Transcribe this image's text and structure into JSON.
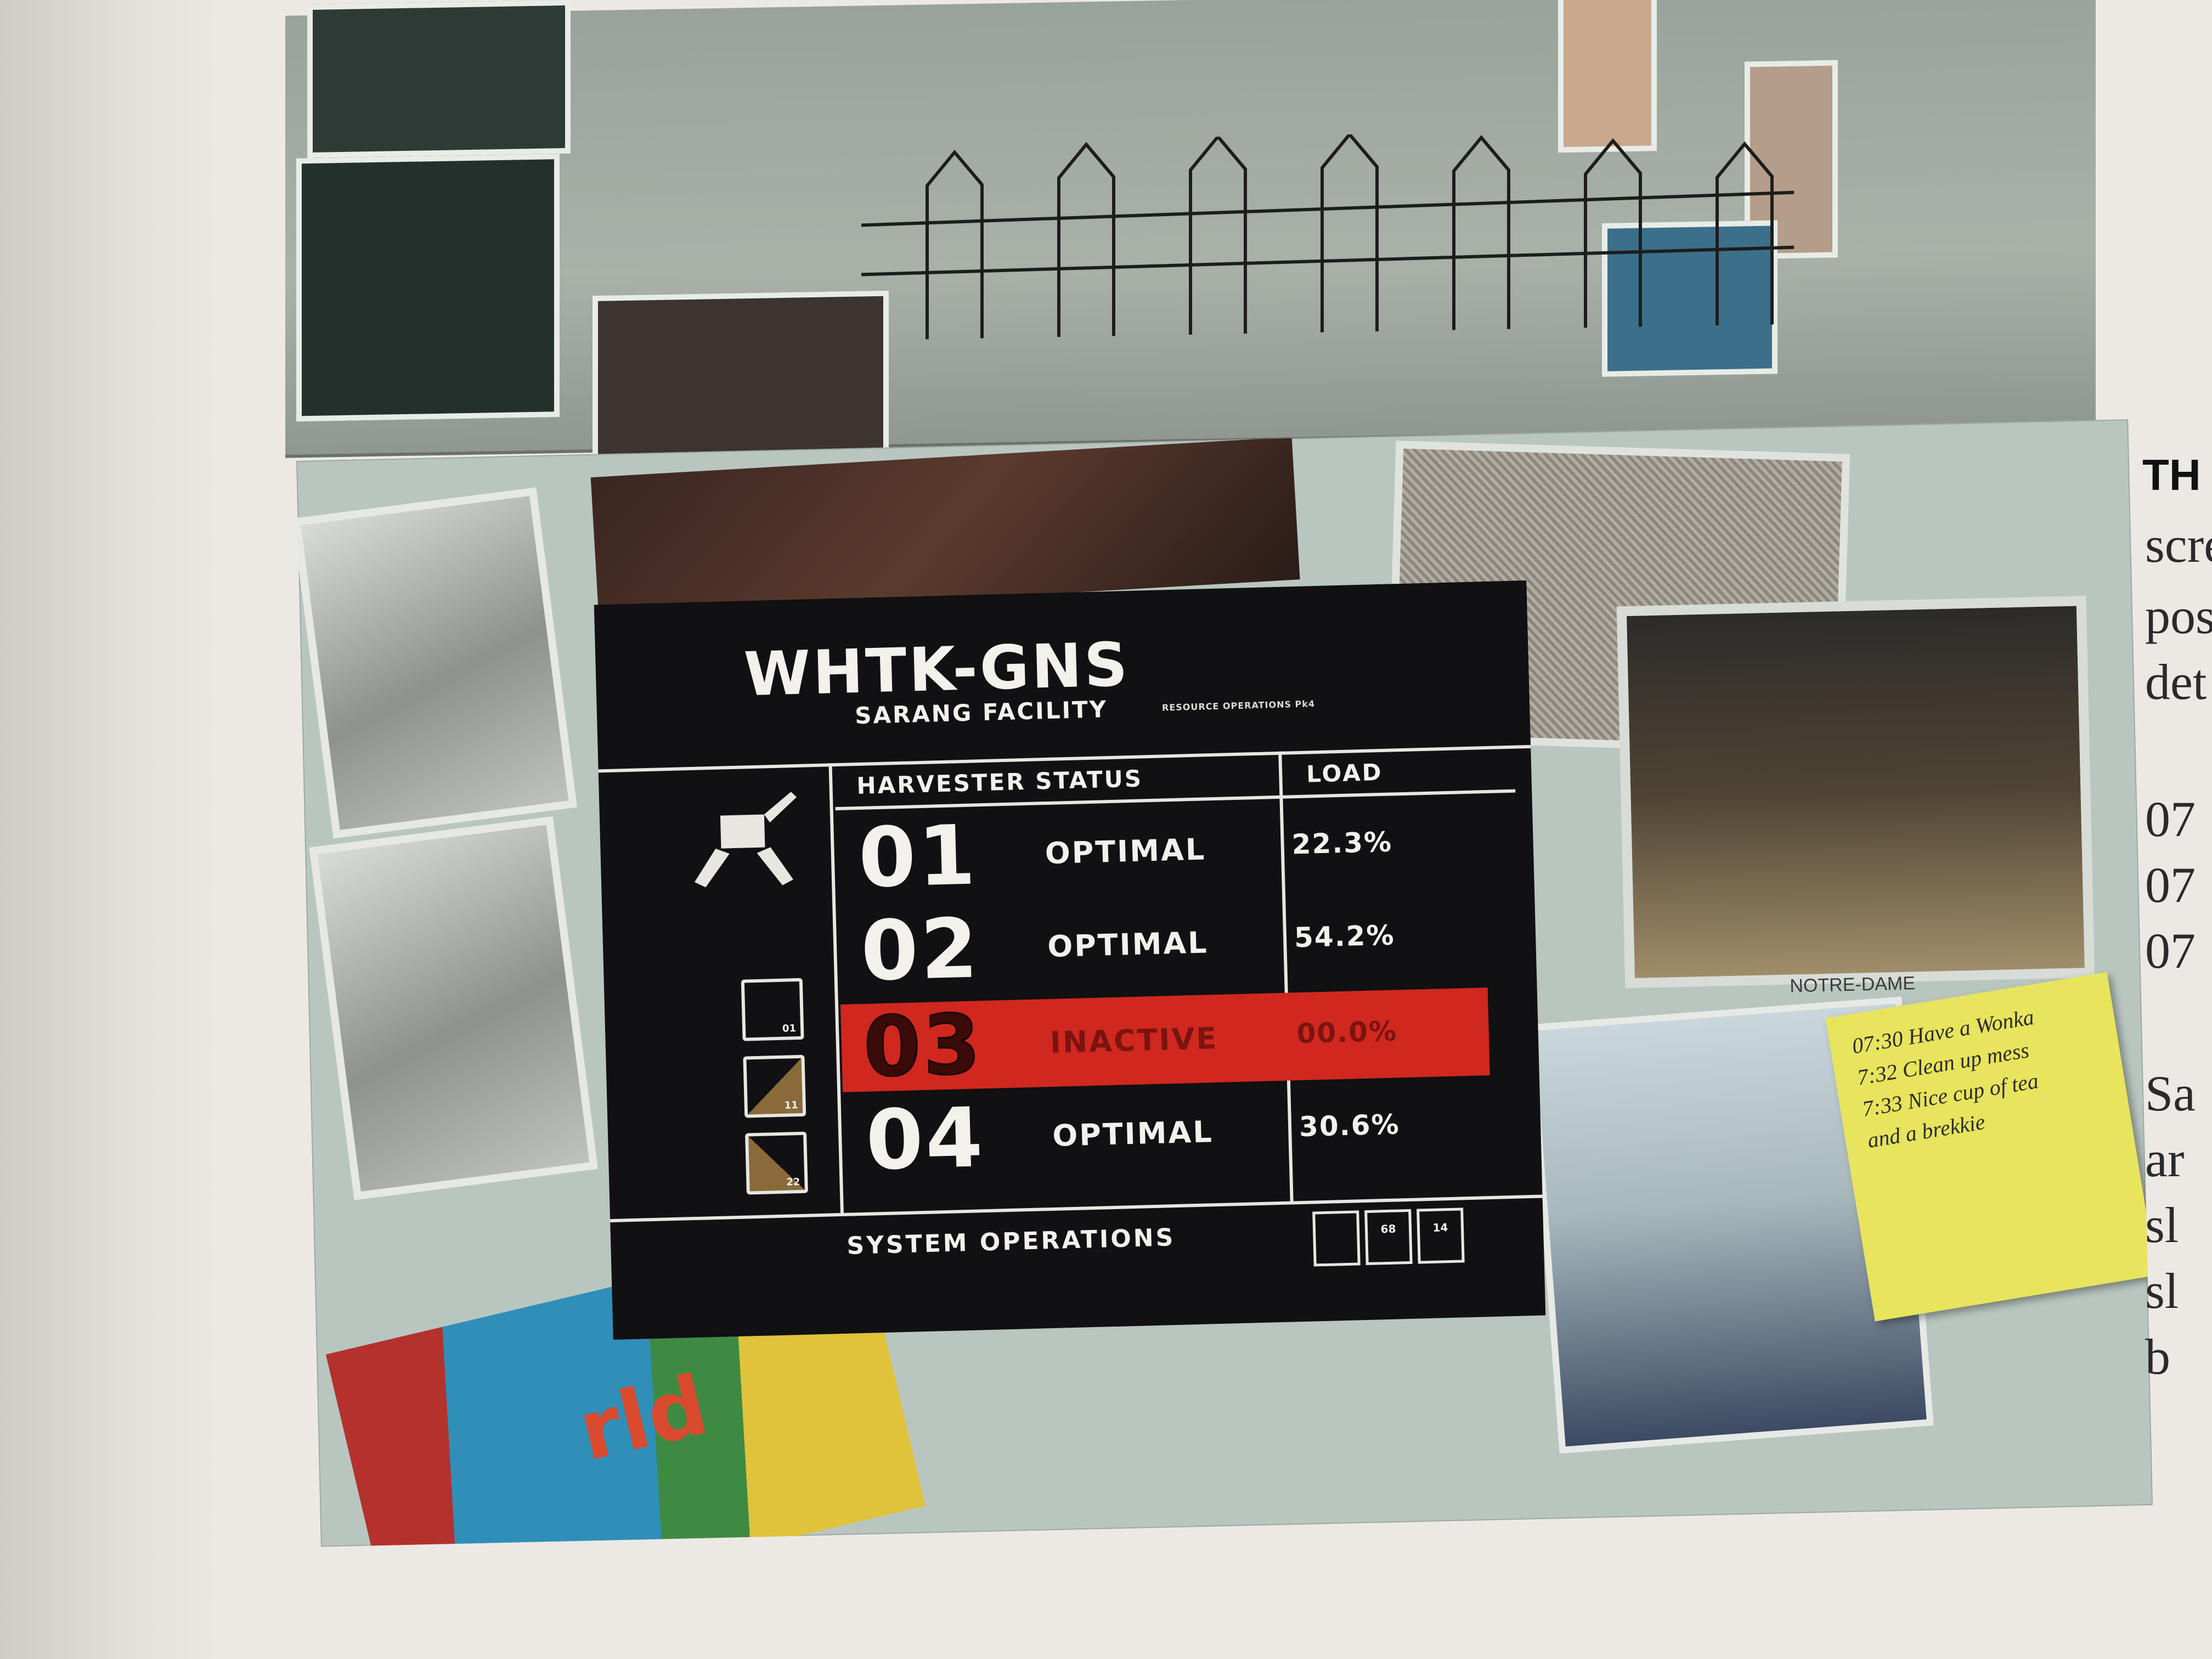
{
  "screen": {
    "title": "WHTK-GNS",
    "subtitle": "SARANG FACILITY",
    "tiny_caption": "RESOURCE OPERATIONS Pk4",
    "table": {
      "headers": {
        "status": "HARVESTER STATUS",
        "load": "LOAD"
      },
      "rows": [
        {
          "num": "01",
          "status": "OPTIMAL",
          "load": "22.3%",
          "active_alert": false
        },
        {
          "num": "02",
          "status": "OPTIMAL",
          "load": "54.2%",
          "active_alert": false
        },
        {
          "num": "03",
          "status": "INACTIVE",
          "load": "00.0%",
          "active_alert": true
        },
        {
          "num": "04",
          "status": "OPTIMAL",
          "load": "30.6%",
          "active_alert": false
        }
      ]
    },
    "side_boxes": [
      {
        "label": "01",
        "icon": "square-box-icon"
      },
      {
        "label": "11",
        "icon": "triangle-box-icon"
      },
      {
        "label": "22",
        "icon": "triangle-box-icon"
      }
    ],
    "harvester_icon": "harvester-icon",
    "system_operations": {
      "label": "SYSTEM OPERATIONS",
      "boxes": [
        "",
        "68",
        "14"
      ]
    },
    "colors": {
      "background": "#111012",
      "foreground": "#f3f1ec",
      "alert": "#d0271f"
    }
  },
  "photo_labels": {
    "notre_dame": "NOTRE-DAME"
  },
  "sticky_note": {
    "lines": [
      "07:30 Have a Wonka",
      "7:32 Clean up mess",
      "7:33 Nice cup of tea",
      "and a brekkie"
    ]
  },
  "toy_letters": "rld",
  "book": {
    "heading": "TH",
    "lines": [
      "scre",
      "pos",
      "det",
      "07",
      "07",
      "07",
      "Sa",
      "ar",
      "sl",
      "sl",
      "b"
    ]
  }
}
